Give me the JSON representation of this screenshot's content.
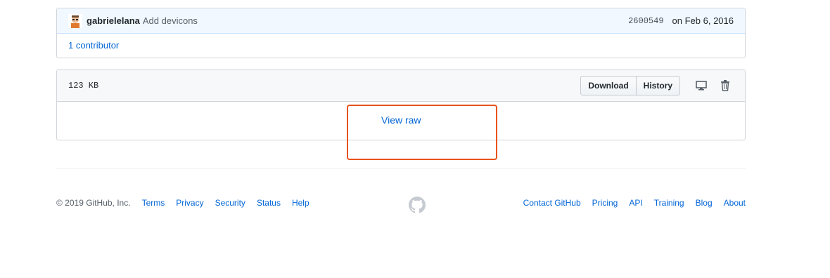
{
  "commit": {
    "author": "gabrielelana",
    "message": "Add devicons",
    "sha": "2600549",
    "date": "on Feb 6, 2016",
    "contributors": "1 contributor"
  },
  "file": {
    "size": "123 KB",
    "download_label": "Download",
    "history_label": "History",
    "view_raw": "View raw",
    "icons": [
      "desktop-icon",
      "trash-icon"
    ]
  },
  "footer": {
    "copyright": "© 2019 GitHub, Inc.",
    "left_links": [
      "Terms",
      "Privacy",
      "Security",
      "Status",
      "Help"
    ],
    "right_links": [
      "Contact GitHub",
      "Pricing",
      "API",
      "Training",
      "Blog",
      "About"
    ],
    "logo": "github-mark-icon"
  },
  "colors": {
    "link": "#0366d6",
    "highlight_border": "#e8521a",
    "commit_header_bg": "#f1f8ff",
    "file_header_bg": "#f6f8fa"
  }
}
